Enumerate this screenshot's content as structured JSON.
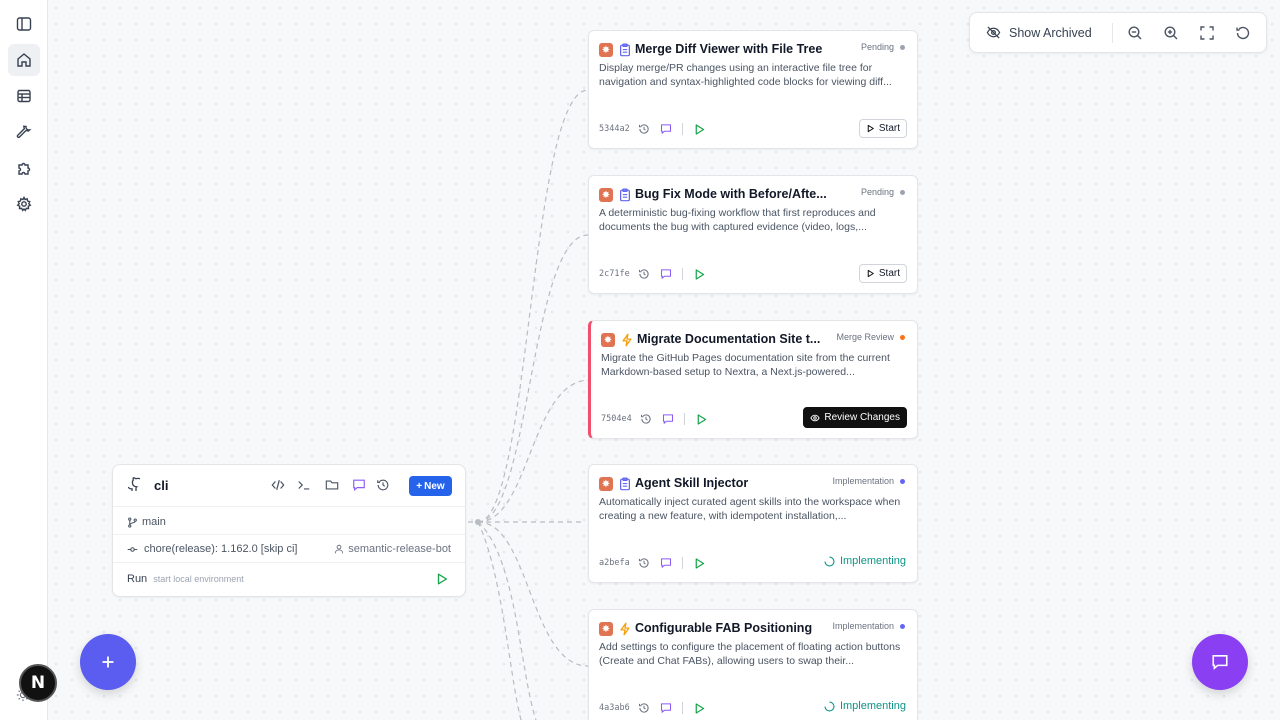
{
  "repo": {
    "name": "cli",
    "new_label": "New",
    "branch": "main",
    "commit_message": "chore(release): 1.162.0 [skip ci]",
    "commit_author": "semantic-release-bot",
    "run_label": "Run",
    "run_hint": "start local environment"
  },
  "features": [
    {
      "title": "Merge Diff Viewer with File Tree",
      "status": "Pending",
      "status_color": "#9ca3af",
      "description": "Display merge/PR changes using an interactive file tree for navigation and syntax-highlighted code blocks for viewing diff...",
      "hash": "5344a2",
      "action_label": "Start",
      "type_icon": "clipboard-icon"
    },
    {
      "title": "Bug Fix Mode with Before/Afte...",
      "status": "Pending",
      "status_color": "#9ca3af",
      "description": "A deterministic bug-fixing workflow that first reproduces and documents the bug with captured evidence (video, logs,...",
      "hash": "2c71fe",
      "action_label": "Start",
      "type_icon": "clipboard-icon"
    },
    {
      "title": "Migrate Documentation Site t...",
      "status": "Merge Review",
      "status_color": "#f97316",
      "description": "Migrate the GitHub Pages documentation site from the current Markdown-based setup to Nextra, a Next.js-powered...",
      "hash": "7504e4",
      "action_label": "Review Changes",
      "type_icon": "lightning-icon"
    },
    {
      "title": "Agent Skill Injector",
      "status": "Implementation",
      "status_color": "#6366f1",
      "description": "Automatically inject curated agent skills into the workspace when creating a new feature, with idempotent installation,...",
      "hash": "a2befa",
      "action_label": "Implementing",
      "type_icon": "clipboard-icon"
    },
    {
      "title": "Configurable FAB Positioning",
      "status": "Implementation",
      "status_color": "#6366f1",
      "description": "Add settings to configure the placement of floating action buttons (Create and Chat FABs), allowing users to swap their...",
      "hash": "4a3ab6",
      "action_label": "Implementing",
      "type_icon": "lightning-icon"
    }
  ],
  "toolbar": {
    "show_archived_label": "Show Archived"
  },
  "user": {
    "avatar_initial": "N"
  },
  "colors": {
    "primary": "#2563eb",
    "fab_add": "#5b5cf0",
    "fab_chat": "#8b3ff2",
    "implementing": "#0d9488",
    "run_green": "#16a34a"
  }
}
